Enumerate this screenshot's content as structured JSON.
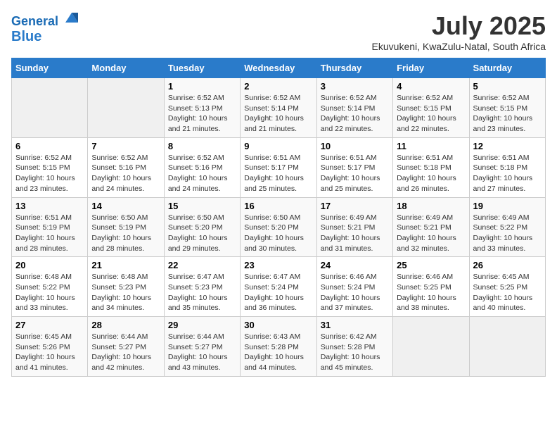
{
  "logo": {
    "line1": "General",
    "line2": "Blue",
    "icon_color": "#2a7bca"
  },
  "title": "July 2025",
  "subtitle": "Ekuvukeni, KwaZulu-Natal, South Africa",
  "days_of_week": [
    "Sunday",
    "Monday",
    "Tuesday",
    "Wednesday",
    "Thursday",
    "Friday",
    "Saturday"
  ],
  "weeks": [
    [
      {
        "day": "",
        "info": ""
      },
      {
        "day": "",
        "info": ""
      },
      {
        "day": "1",
        "info": "Sunrise: 6:52 AM\nSunset: 5:13 PM\nDaylight: 10 hours and 21 minutes."
      },
      {
        "day": "2",
        "info": "Sunrise: 6:52 AM\nSunset: 5:14 PM\nDaylight: 10 hours and 21 minutes."
      },
      {
        "day": "3",
        "info": "Sunrise: 6:52 AM\nSunset: 5:14 PM\nDaylight: 10 hours and 22 minutes."
      },
      {
        "day": "4",
        "info": "Sunrise: 6:52 AM\nSunset: 5:15 PM\nDaylight: 10 hours and 22 minutes."
      },
      {
        "day": "5",
        "info": "Sunrise: 6:52 AM\nSunset: 5:15 PM\nDaylight: 10 hours and 23 minutes."
      }
    ],
    [
      {
        "day": "6",
        "info": "Sunrise: 6:52 AM\nSunset: 5:15 PM\nDaylight: 10 hours and 23 minutes."
      },
      {
        "day": "7",
        "info": "Sunrise: 6:52 AM\nSunset: 5:16 PM\nDaylight: 10 hours and 24 minutes."
      },
      {
        "day": "8",
        "info": "Sunrise: 6:52 AM\nSunset: 5:16 PM\nDaylight: 10 hours and 24 minutes."
      },
      {
        "day": "9",
        "info": "Sunrise: 6:51 AM\nSunset: 5:17 PM\nDaylight: 10 hours and 25 minutes."
      },
      {
        "day": "10",
        "info": "Sunrise: 6:51 AM\nSunset: 5:17 PM\nDaylight: 10 hours and 25 minutes."
      },
      {
        "day": "11",
        "info": "Sunrise: 6:51 AM\nSunset: 5:18 PM\nDaylight: 10 hours and 26 minutes."
      },
      {
        "day": "12",
        "info": "Sunrise: 6:51 AM\nSunset: 5:18 PM\nDaylight: 10 hours and 27 minutes."
      }
    ],
    [
      {
        "day": "13",
        "info": "Sunrise: 6:51 AM\nSunset: 5:19 PM\nDaylight: 10 hours and 28 minutes."
      },
      {
        "day": "14",
        "info": "Sunrise: 6:50 AM\nSunset: 5:19 PM\nDaylight: 10 hours and 28 minutes."
      },
      {
        "day": "15",
        "info": "Sunrise: 6:50 AM\nSunset: 5:20 PM\nDaylight: 10 hours and 29 minutes."
      },
      {
        "day": "16",
        "info": "Sunrise: 6:50 AM\nSunset: 5:20 PM\nDaylight: 10 hours and 30 minutes."
      },
      {
        "day": "17",
        "info": "Sunrise: 6:49 AM\nSunset: 5:21 PM\nDaylight: 10 hours and 31 minutes."
      },
      {
        "day": "18",
        "info": "Sunrise: 6:49 AM\nSunset: 5:21 PM\nDaylight: 10 hours and 32 minutes."
      },
      {
        "day": "19",
        "info": "Sunrise: 6:49 AM\nSunset: 5:22 PM\nDaylight: 10 hours and 33 minutes."
      }
    ],
    [
      {
        "day": "20",
        "info": "Sunrise: 6:48 AM\nSunset: 5:22 PM\nDaylight: 10 hours and 33 minutes."
      },
      {
        "day": "21",
        "info": "Sunrise: 6:48 AM\nSunset: 5:23 PM\nDaylight: 10 hours and 34 minutes."
      },
      {
        "day": "22",
        "info": "Sunrise: 6:47 AM\nSunset: 5:23 PM\nDaylight: 10 hours and 35 minutes."
      },
      {
        "day": "23",
        "info": "Sunrise: 6:47 AM\nSunset: 5:24 PM\nDaylight: 10 hours and 36 minutes."
      },
      {
        "day": "24",
        "info": "Sunrise: 6:46 AM\nSunset: 5:24 PM\nDaylight: 10 hours and 37 minutes."
      },
      {
        "day": "25",
        "info": "Sunrise: 6:46 AM\nSunset: 5:25 PM\nDaylight: 10 hours and 38 minutes."
      },
      {
        "day": "26",
        "info": "Sunrise: 6:45 AM\nSunset: 5:25 PM\nDaylight: 10 hours and 40 minutes."
      }
    ],
    [
      {
        "day": "27",
        "info": "Sunrise: 6:45 AM\nSunset: 5:26 PM\nDaylight: 10 hours and 41 minutes."
      },
      {
        "day": "28",
        "info": "Sunrise: 6:44 AM\nSunset: 5:27 PM\nDaylight: 10 hours and 42 minutes."
      },
      {
        "day": "29",
        "info": "Sunrise: 6:44 AM\nSunset: 5:27 PM\nDaylight: 10 hours and 43 minutes."
      },
      {
        "day": "30",
        "info": "Sunrise: 6:43 AM\nSunset: 5:28 PM\nDaylight: 10 hours and 44 minutes."
      },
      {
        "day": "31",
        "info": "Sunrise: 6:42 AM\nSunset: 5:28 PM\nDaylight: 10 hours and 45 minutes."
      },
      {
        "day": "",
        "info": ""
      },
      {
        "day": "",
        "info": ""
      }
    ]
  ]
}
